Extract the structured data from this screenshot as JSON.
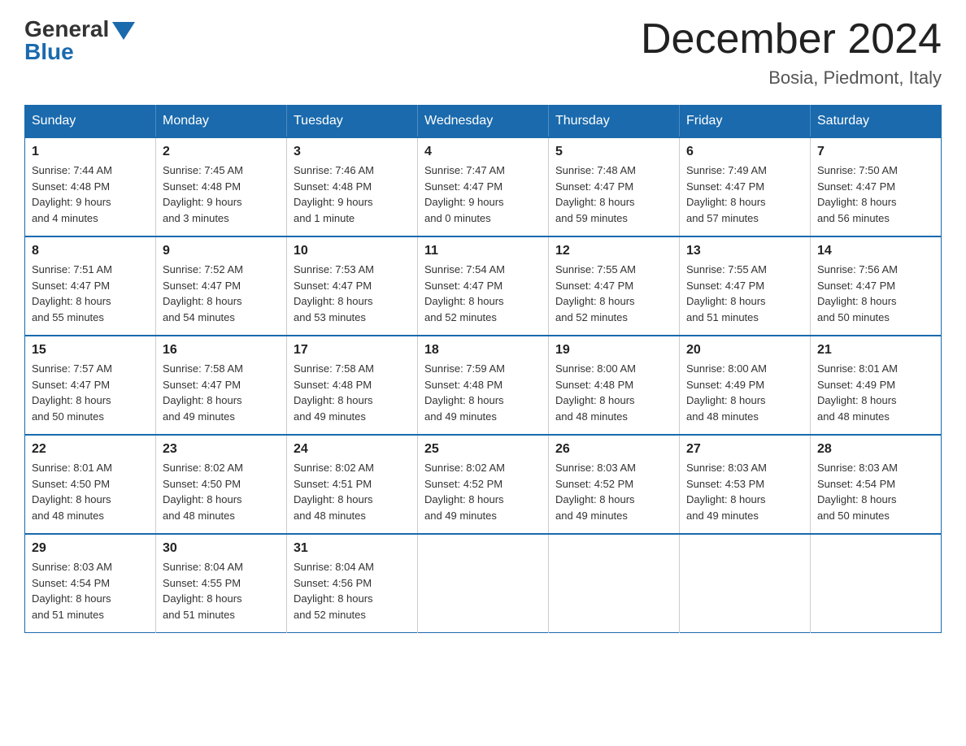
{
  "header": {
    "logo_general": "General",
    "logo_blue": "Blue",
    "month_title": "December 2024",
    "location": "Bosia, Piedmont, Italy"
  },
  "weekdays": [
    "Sunday",
    "Monday",
    "Tuesday",
    "Wednesday",
    "Thursday",
    "Friday",
    "Saturday"
  ],
  "weeks": [
    [
      {
        "day": "1",
        "sunrise": "7:44 AM",
        "sunset": "4:48 PM",
        "daylight": "9 hours and 4 minutes."
      },
      {
        "day": "2",
        "sunrise": "7:45 AM",
        "sunset": "4:48 PM",
        "daylight": "9 hours and 3 minutes."
      },
      {
        "day": "3",
        "sunrise": "7:46 AM",
        "sunset": "4:48 PM",
        "daylight": "9 hours and 1 minute."
      },
      {
        "day": "4",
        "sunrise": "7:47 AM",
        "sunset": "4:47 PM",
        "daylight": "9 hours and 0 minutes."
      },
      {
        "day": "5",
        "sunrise": "7:48 AM",
        "sunset": "4:47 PM",
        "daylight": "8 hours and 59 minutes."
      },
      {
        "day": "6",
        "sunrise": "7:49 AM",
        "sunset": "4:47 PM",
        "daylight": "8 hours and 57 minutes."
      },
      {
        "day": "7",
        "sunrise": "7:50 AM",
        "sunset": "4:47 PM",
        "daylight": "8 hours and 56 minutes."
      }
    ],
    [
      {
        "day": "8",
        "sunrise": "7:51 AM",
        "sunset": "4:47 PM",
        "daylight": "8 hours and 55 minutes."
      },
      {
        "day": "9",
        "sunrise": "7:52 AM",
        "sunset": "4:47 PM",
        "daylight": "8 hours and 54 minutes."
      },
      {
        "day": "10",
        "sunrise": "7:53 AM",
        "sunset": "4:47 PM",
        "daylight": "8 hours and 53 minutes."
      },
      {
        "day": "11",
        "sunrise": "7:54 AM",
        "sunset": "4:47 PM",
        "daylight": "8 hours and 52 minutes."
      },
      {
        "day": "12",
        "sunrise": "7:55 AM",
        "sunset": "4:47 PM",
        "daylight": "8 hours and 52 minutes."
      },
      {
        "day": "13",
        "sunrise": "7:55 AM",
        "sunset": "4:47 PM",
        "daylight": "8 hours and 51 minutes."
      },
      {
        "day": "14",
        "sunrise": "7:56 AM",
        "sunset": "4:47 PM",
        "daylight": "8 hours and 50 minutes."
      }
    ],
    [
      {
        "day": "15",
        "sunrise": "7:57 AM",
        "sunset": "4:47 PM",
        "daylight": "8 hours and 50 minutes."
      },
      {
        "day": "16",
        "sunrise": "7:58 AM",
        "sunset": "4:47 PM",
        "daylight": "8 hours and 49 minutes."
      },
      {
        "day": "17",
        "sunrise": "7:58 AM",
        "sunset": "4:48 PM",
        "daylight": "8 hours and 49 minutes."
      },
      {
        "day": "18",
        "sunrise": "7:59 AM",
        "sunset": "4:48 PM",
        "daylight": "8 hours and 49 minutes."
      },
      {
        "day": "19",
        "sunrise": "8:00 AM",
        "sunset": "4:48 PM",
        "daylight": "8 hours and 48 minutes."
      },
      {
        "day": "20",
        "sunrise": "8:00 AM",
        "sunset": "4:49 PM",
        "daylight": "8 hours and 48 minutes."
      },
      {
        "day": "21",
        "sunrise": "8:01 AM",
        "sunset": "4:49 PM",
        "daylight": "8 hours and 48 minutes."
      }
    ],
    [
      {
        "day": "22",
        "sunrise": "8:01 AM",
        "sunset": "4:50 PM",
        "daylight": "8 hours and 48 minutes."
      },
      {
        "day": "23",
        "sunrise": "8:02 AM",
        "sunset": "4:50 PM",
        "daylight": "8 hours and 48 minutes."
      },
      {
        "day": "24",
        "sunrise": "8:02 AM",
        "sunset": "4:51 PM",
        "daylight": "8 hours and 48 minutes."
      },
      {
        "day": "25",
        "sunrise": "8:02 AM",
        "sunset": "4:52 PM",
        "daylight": "8 hours and 49 minutes."
      },
      {
        "day": "26",
        "sunrise": "8:03 AM",
        "sunset": "4:52 PM",
        "daylight": "8 hours and 49 minutes."
      },
      {
        "day": "27",
        "sunrise": "8:03 AM",
        "sunset": "4:53 PM",
        "daylight": "8 hours and 49 minutes."
      },
      {
        "day": "28",
        "sunrise": "8:03 AM",
        "sunset": "4:54 PM",
        "daylight": "8 hours and 50 minutes."
      }
    ],
    [
      {
        "day": "29",
        "sunrise": "8:03 AM",
        "sunset": "4:54 PM",
        "daylight": "8 hours and 51 minutes."
      },
      {
        "day": "30",
        "sunrise": "8:04 AM",
        "sunset": "4:55 PM",
        "daylight": "8 hours and 51 minutes."
      },
      {
        "day": "31",
        "sunrise": "8:04 AM",
        "sunset": "4:56 PM",
        "daylight": "8 hours and 52 minutes."
      },
      null,
      null,
      null,
      null
    ]
  ],
  "labels": {
    "sunrise": "Sunrise:",
    "sunset": "Sunset:",
    "daylight": "Daylight:"
  }
}
